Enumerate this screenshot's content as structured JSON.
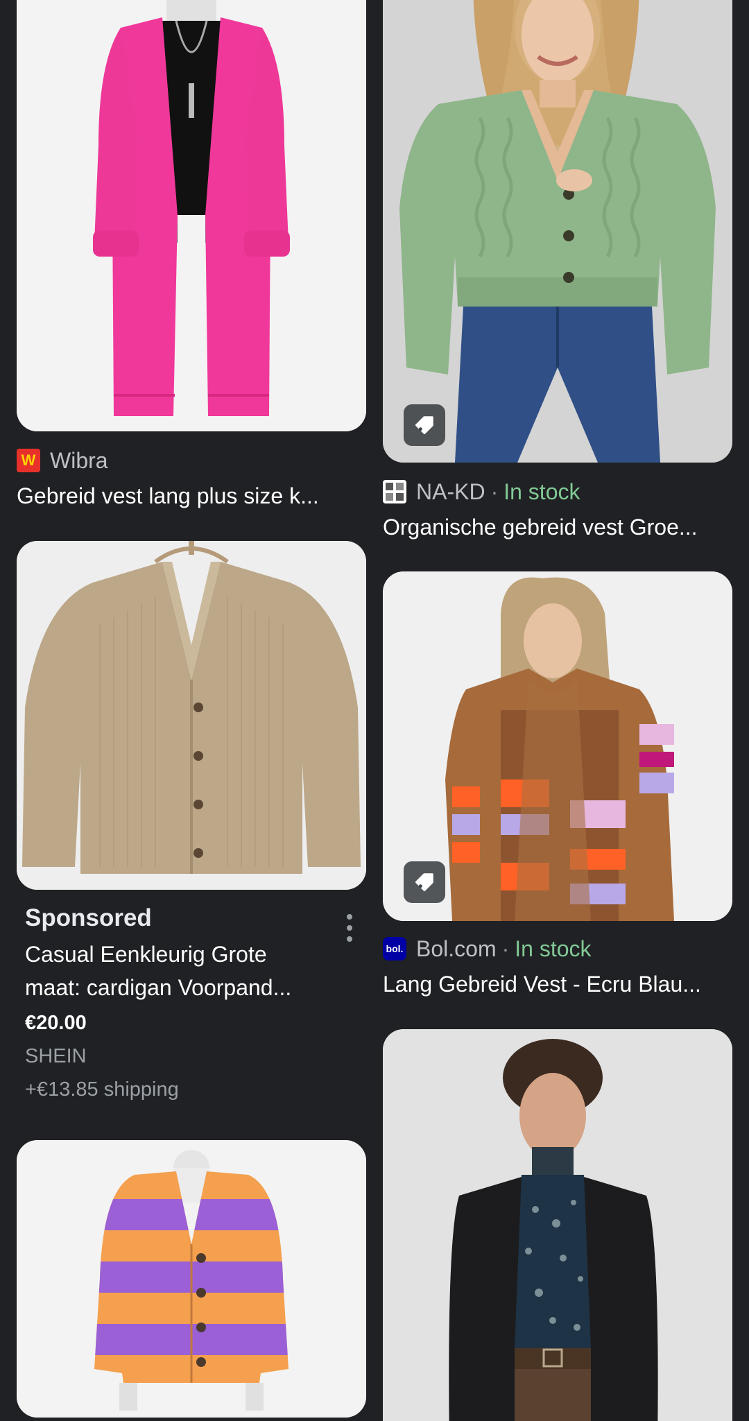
{
  "results": [
    {
      "source": "Wibra",
      "title": "Gebreid vest lang plus size k...",
      "image": "pink-long-cardigan-image",
      "has_tag_icon": false
    },
    {
      "source": "NA-KD",
      "separator": "·",
      "stock": "In stock",
      "title": "Organische gebreid vest Groe...",
      "image": "green-cable-knit-cardigan-image",
      "has_tag_icon": true
    },
    {
      "source": "Bol.com",
      "separator": "·",
      "stock": "In stock",
      "title": "Lang Gebreid Vest - Ecru Blau...",
      "image": "striped-long-cardigan-image",
      "has_tag_icon": true
    }
  ],
  "sponsored": {
    "label": "Sponsored",
    "title": "Casual Eenkleurig Grote maat: cardigan Voorpand...",
    "price": "€20.00",
    "merchant": "SHEIN",
    "shipping": "+€13.85 shipping",
    "image": "beige-button-cardigan-image"
  },
  "more_images": [
    "orange-purple-striped-cardigan-image",
    "black-cardigan-model-image"
  ],
  "colors": {
    "background": "#202124",
    "in_stock": "#81c995",
    "wibra_brand": "#e8312a",
    "bol_brand": "#0000a4"
  },
  "icons": [
    "tag-icon",
    "more-vert-icon",
    "wibra-favicon",
    "nakd-favicon",
    "bol-favicon"
  ],
  "favicon_text": {
    "wibra": "W",
    "bol": "bol."
  }
}
